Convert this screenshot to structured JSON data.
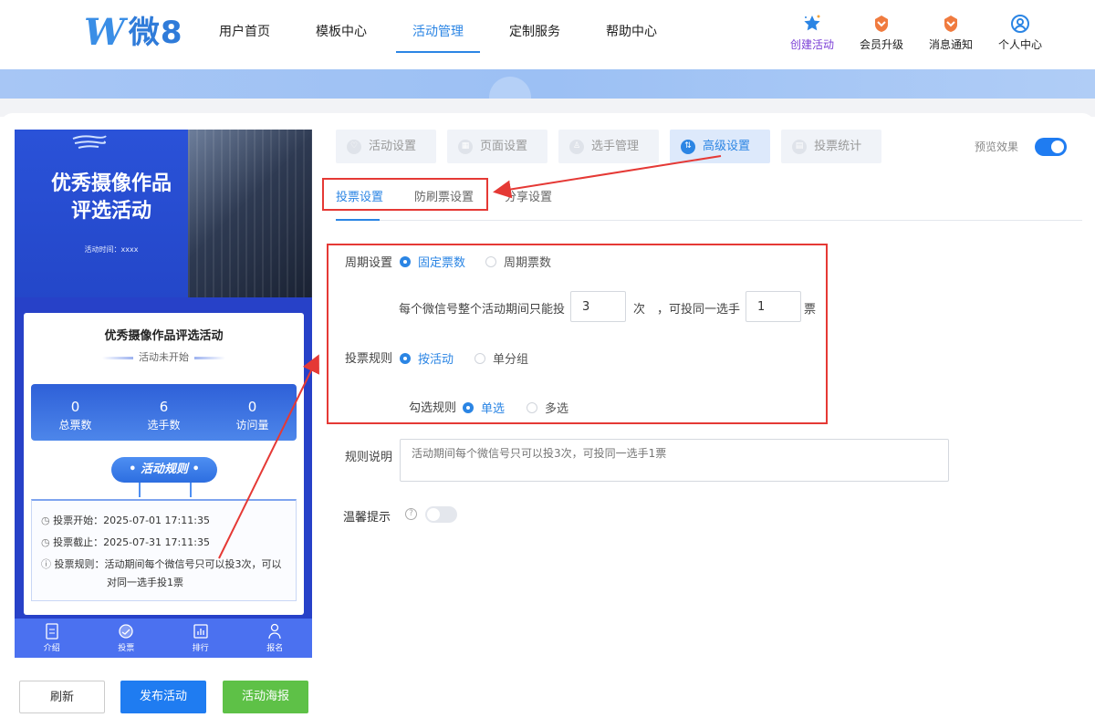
{
  "header": {
    "logo_mark": "W",
    "logo_text": "微8",
    "nav": [
      "用户首页",
      "模板中心",
      "活动管理",
      "定制服务",
      "帮助中心"
    ],
    "actions": [
      {
        "label": "创建活动",
        "icon": "star-icon"
      },
      {
        "label": "会员升级",
        "icon": "member-badge-icon"
      },
      {
        "label": "消息通知",
        "icon": "notification-badge-icon"
      },
      {
        "label": "个人中心",
        "icon": "user-circle-icon"
      }
    ]
  },
  "preview": {
    "poster_title_line1": "优秀摄像作品",
    "poster_title_line2": "评选活动",
    "poster_time": "活动时间：xxxx",
    "card_title": "优秀摄像作品评选活动",
    "status": "活动未开始",
    "stats": [
      {
        "value": "0",
        "label": "总票数"
      },
      {
        "value": "6",
        "label": "选手数"
      },
      {
        "value": "0",
        "label": "访问量"
      }
    ],
    "rule_title": "活动规则",
    "vote_start_label": "投票开始：",
    "vote_start": "2025-07-01 17:11:35",
    "vote_end_label": "投票截止：",
    "vote_end": "2025-07-31 17:11:35",
    "vote_rule_label": "投票规则：",
    "vote_rule": "活动期间每个微信号只可以投3次，可以对同一选手投1票",
    "tabs": [
      "介绍",
      "投票",
      "排行",
      "报名"
    ]
  },
  "buttons": {
    "refresh": "刷新",
    "publish": "发布活动",
    "poster": "活动海报"
  },
  "settings": {
    "top_tabs": [
      "活动设置",
      "页面设置",
      "选手管理",
      "高级设置",
      "投票统计"
    ],
    "preview_label": "预览效果",
    "sub_tabs": [
      "投票设置",
      "防刷票设置",
      "分享设置"
    ],
    "period_label": "周期设置",
    "period_options": [
      "固定票数",
      "周期票数"
    ],
    "limit_text_1": "每个微信号整个活动期间只能投",
    "limit_value": "3",
    "limit_text_2": "次",
    "limit_text_3": "，可投同一选手",
    "per_player_value": "1",
    "limit_text_4": "票",
    "rule_label": "投票规则",
    "rule_options": [
      "按活动",
      "单分组"
    ],
    "check_label": "勾选规则",
    "check_options": [
      "单选",
      "多选"
    ],
    "desc_label": "规则说明",
    "desc_placeholder": "活动期间每个微信号只可以投3次，可投同一选手1票",
    "tip_label": "温馨提示",
    "help_symbol": "?"
  },
  "colors": {
    "accent": "#2b85e4",
    "annotation": "#e53935",
    "publish": "#1f7cf1",
    "poster": "#5ec147"
  }
}
